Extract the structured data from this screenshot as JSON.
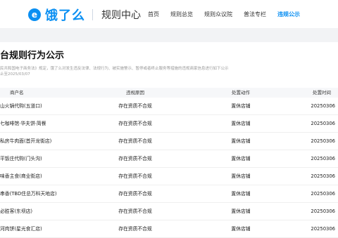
{
  "header": {
    "logo_text": "饿了么",
    "logo_subtitle": "规则中心",
    "nav": [
      "首页",
      "规则总览",
      "规则众议院",
      "普法专栏",
      "违规公示"
    ],
    "active_nav": 4
  },
  "page": {
    "title": "台规则行为公示",
    "description_line1": "民共和国电子商务法》规定，饿了么对发生违反法律、法规行为、被实施警示、暂停或者终止服务等措施的违规商家信息进行如下公示",
    "description_line2": "止至2025/03/07"
  },
  "table": {
    "headers": [
      "商户名",
      "违规原因",
      "处置动作",
      "处置时间"
    ],
    "rows": [
      [
        "山火锅代购(五道口)",
        "存在资质不合规",
        "置休店铺",
        "20250306"
      ],
      [
        "七咖啡馆·华夫饼·简餐",
        "存在资质不合规",
        "置休店铺",
        "20250306"
      ],
      [
        "私房牛肉面(首开龙街店)",
        "存在资质不合规",
        "置休店铺",
        "20250306"
      ],
      [
        "平饭庄代购(门头沟)",
        "存在资质不合规",
        "置休店铺",
        "20250306"
      ],
      [
        "味香主食(商业街店)",
        "存在资质不合规",
        "置休店铺",
        "20250306"
      ],
      [
        "串香(TBD住总万科天地店)",
        "存在资质不合规",
        "置休店铺",
        "20250306"
      ],
      [
        "必胜客(东坝店)",
        "存在资质不合规",
        "置休店铺",
        "20250306"
      ],
      [
        "河肉饼(星光食汇店)",
        "存在资质不合规",
        "置休店铺",
        "20250306"
      ]
    ]
  },
  "colors": {
    "brand": "#0a8ff2"
  }
}
